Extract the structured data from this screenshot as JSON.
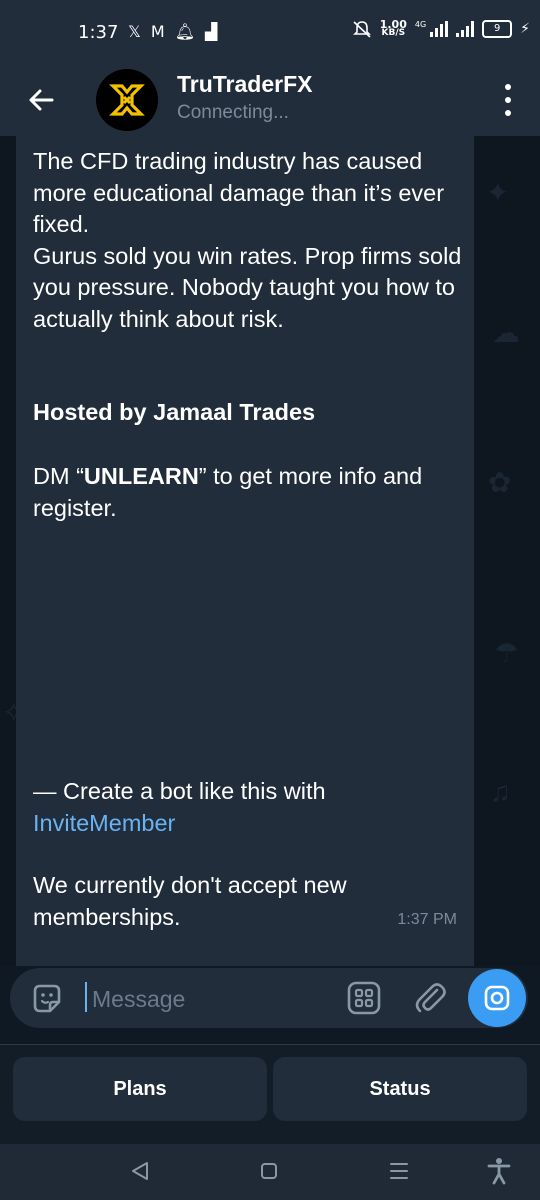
{
  "status_bar": {
    "time": "1:37",
    "net_speed_value": "1.00",
    "net_speed_unit": "KB/S",
    "network_type": "4G",
    "battery": "9"
  },
  "header": {
    "title": "TruTraderFX",
    "status": "Connecting..."
  },
  "message": {
    "paragraph1": "The CFD trading industry has caused more educational damage than it’s ever fixed.\nGurus sold you win rates. Prop firms sold you pressure. Nobody taught you how to actually think about risk.",
    "hosted_by": "Hosted by Jamaal Trades",
    "dm_prefix": "DM “",
    "dm_keyword": "UNLEARN",
    "dm_suffix": "” to get more info and register.",
    "bot_prefix": "— Create a bot like this with",
    "bot_link": "InviteMember",
    "closing": "We currently don't accept new memberships.",
    "time": "1:37 PM"
  },
  "input": {
    "placeholder": "Message"
  },
  "keyboard": {
    "buttons": [
      "Plans",
      "Status"
    ]
  },
  "colors": {
    "accent": "#3a9df3",
    "link": "#6ab2f2",
    "bubble": "#212d3b",
    "background": "#0e1620"
  }
}
